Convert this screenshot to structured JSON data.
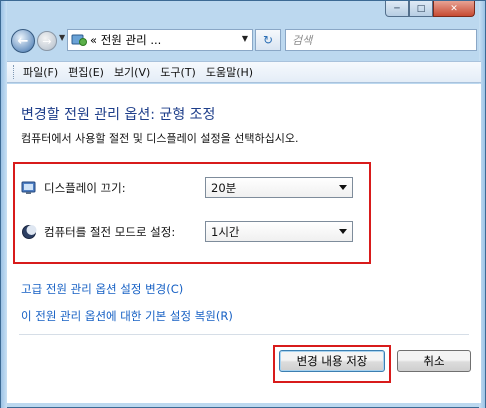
{
  "window": {
    "caption_buttons": {
      "minimize_icon": "minimize-icon",
      "maximize_icon": "maximize-icon",
      "close_icon": "close-icon"
    }
  },
  "toolbar": {
    "address_text": "« 전원 관리 ...",
    "search_placeholder": "검색"
  },
  "menu": {
    "items": [
      "파일(F)",
      "편집(E)",
      "보기(V)",
      "도구(T)",
      "도움말(H)"
    ]
  },
  "page": {
    "title": "변경할 전원 관리 옵션: 균형 조정",
    "subtitle": "컴퓨터에서 사용할 절전 및 디스플레이 설정을 선택하십시오."
  },
  "settings": {
    "display_off": {
      "label": "디스플레이 끄기:",
      "value": "20분",
      "icon": "display-icon"
    },
    "sleep": {
      "label": "컴퓨터를 절전 모드로 설정:",
      "value": "1시간",
      "icon": "moon-icon"
    }
  },
  "links": {
    "advanced": "고급 전원 관리 옵션 설정 변경(C)",
    "restore": "이 전원 관리 옵션에 대한 기본 설정 복원(R)"
  },
  "buttons": {
    "save": "변경 내용 저장",
    "cancel": "취소"
  },
  "colors": {
    "highlight": "#d81b1b",
    "title": "#1e3e8a",
    "link": "#1660c4"
  }
}
